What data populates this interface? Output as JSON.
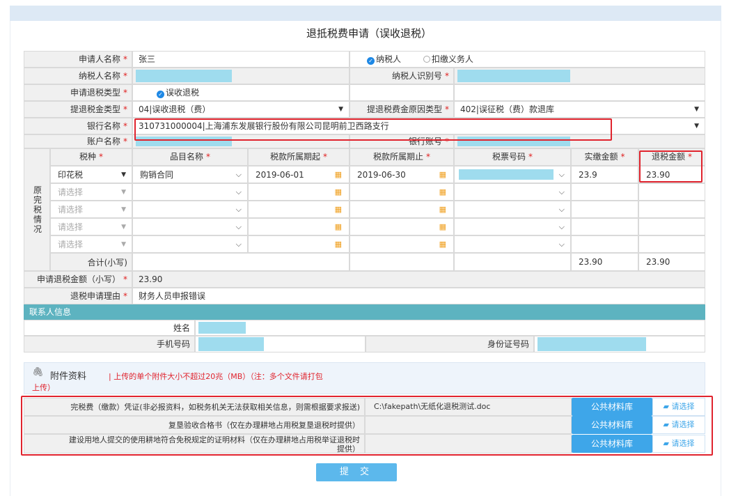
{
  "title": "退抵税费申请（误收退税）",
  "form": {
    "applicant_label": "申请人名称",
    "applicant_value": "张三",
    "role_taxpayer": "纳税人",
    "role_withholder": "扣缴义务人",
    "taxpayer_name_label": "纳税人名称",
    "taxpayer_id_label": "纳税人识别号",
    "refund_type_label": "申请退税类型",
    "refund_type_value": "误收退税",
    "amount_type_label": "提退税金类型",
    "amount_type_value": "04|误收退税（费）",
    "reason_type_label": "提退税费金原因类型",
    "reason_type_value": "402|误征税（费）款退库",
    "bank_label": "银行名称",
    "bank_value": "310731000004|上海浦东发展银行股份有限公司昆明前卫西路支行",
    "account_name_label": "账户名称",
    "account_no_label": "银行账号",
    "required_mark": "*"
  },
  "table": {
    "side_label": "原完税情况",
    "headers": [
      "税种",
      "品目名称",
      "税款所属期起",
      "税款所属期止",
      "税票号码",
      "实缴金额",
      "退税金额"
    ],
    "row1": {
      "tax": "印花税",
      "item": "购销合同",
      "start": "2019-06-01",
      "end": "2019-06-30",
      "paid": "23.9",
      "refund": "23.90"
    },
    "placeholder": "请选择",
    "total_label": "合计(小写)",
    "total_paid": "23.90",
    "total_refund": "23.90"
  },
  "apply_amount_label": "申请退税金额（小写）",
  "apply_amount_value": "23.90",
  "reason_label": "退税申请理由",
  "reason_value": "财务人员申报错误",
  "contact": {
    "section": "联系人信息",
    "name_label": "姓名",
    "phone_label": "手机号码",
    "idcard_label": "身份证号码"
  },
  "attach": {
    "title": "附件资料",
    "note_line1": "| 上传的单个附件大小不超过20兆（MB）（注：多个文件请打包",
    "note_line2": "上传）",
    "rows": [
      {
        "label": "完税费（缴款）凭证(非必报资料，如税务机关无法获取相关信息，则需根据要求报送)",
        "file": "C:\\fakepath\\无纸化退税测试.doc"
      },
      {
        "label": "复垦验收合格书（仅在办理耕地占用税复垦退税时提供）",
        "file": ""
      },
      {
        "label_l1": "建设用地人提交的使用耕地符合免税规定的证明材料（仅在办理耕地占用税举证退税时",
        "label_l2": "提供）",
        "file": ""
      }
    ],
    "lib_btn": "公共材料库",
    "choose_btn": "请选择"
  },
  "submit": "提 交",
  "colors": {
    "accent": "#3ea6e9",
    "section_bar": "#5db3c0",
    "highlight": "#e0232d",
    "mask": "#9fdcee"
  }
}
